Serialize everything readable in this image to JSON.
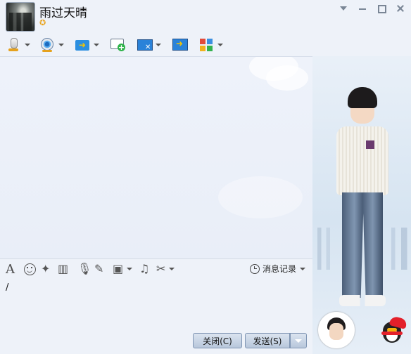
{
  "window": {
    "contact_name": "雨过天晴",
    "status_icon": "star-icon",
    "controls": [
      "dropdown-icon",
      "minimize-icon",
      "maximize-icon",
      "close-icon"
    ]
  },
  "toolbar": {
    "items": [
      {
        "name": "voice-call",
        "icon": "microphone-icon",
        "has_dropdown": true
      },
      {
        "name": "video-call",
        "icon": "webcam-icon",
        "has_dropdown": true
      },
      {
        "name": "send-file",
        "icon": "folder-transfer-icon",
        "has_dropdown": true
      },
      {
        "name": "create-discussion",
        "icon": "chat-add-icon",
        "has_dropdown": false
      },
      {
        "name": "remote-assist",
        "icon": "remote-desktop-icon",
        "has_dropdown": true
      },
      {
        "name": "share-screen",
        "icon": "screen-share-icon",
        "has_dropdown": false
      },
      {
        "name": "apps",
        "icon": "apps-grid-icon",
        "has_dropdown": true
      }
    ]
  },
  "input_toolbar": {
    "items": [
      "font-icon",
      "emoji-icon",
      "poke-icon",
      "video-clip-icon",
      "voice-message-icon",
      "handwrite-icon",
      "image-icon",
      "music-icon",
      "screenshot-icon"
    ],
    "font_glyph": "A",
    "history_label": "消息记录"
  },
  "input": {
    "value": "/"
  },
  "buttons": {
    "close_label": "关闭(C)",
    "send_label": "发送(S)"
  },
  "colors": {
    "background": "#eef2f9",
    "button": "#c9d6e7",
    "accent": "#2a82d9"
  }
}
